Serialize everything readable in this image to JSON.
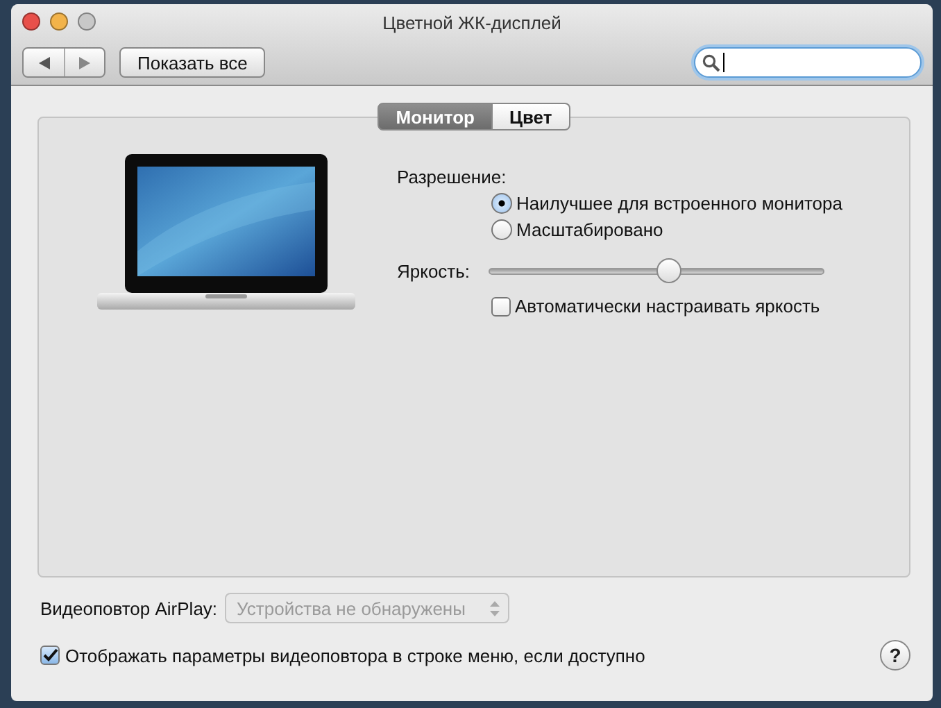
{
  "window": {
    "title": "Цветной ЖК-дисплей"
  },
  "toolbar": {
    "show_all": "Показать все"
  },
  "tabs": [
    {
      "label": "Монитор",
      "selected": true
    },
    {
      "label": "Цвет",
      "selected": false
    }
  ],
  "resolution": {
    "label": "Разрешение:",
    "options": [
      {
        "label": "Наилучшее для встроенного монитора",
        "selected": true
      },
      {
        "label": "Масштабировано",
        "selected": false
      }
    ]
  },
  "brightness": {
    "label": "Яркость:",
    "level": 0.54,
    "auto": {
      "label": "Автоматически настраивать яркость",
      "checked": false
    }
  },
  "airplay": {
    "label": "Видеоповтор AirPlay:",
    "value": "Устройства не обнаружены",
    "disabled": true
  },
  "show_in_menu": {
    "label": "Отображать параметры видеоповтора в строке меню, если доступно",
    "checked": true
  },
  "help": "?"
}
